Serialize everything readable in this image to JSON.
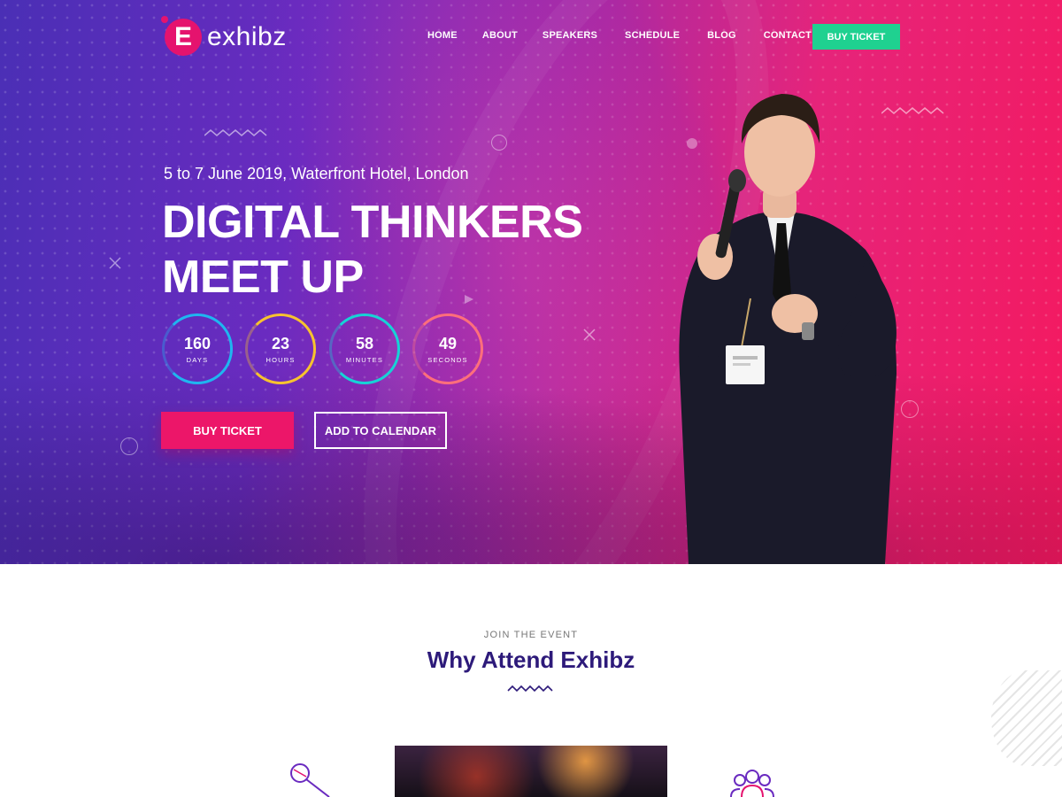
{
  "brand": {
    "name": "exhibz",
    "mark": "E"
  },
  "nav": {
    "items": [
      "HOME",
      "ABOUT",
      "SPEAKERS",
      "SCHEDULE",
      "BLOG",
      "CONTACT"
    ],
    "cta": "BUY TICKET"
  },
  "hero": {
    "date_location": "5 to 7 June 2019, Waterfront Hotel, London",
    "title_line1": "DIGITAL THINKERS",
    "title_line2": "MEET UP",
    "countdown": [
      {
        "value": "160",
        "label": "DAYS",
        "color": "#1fb6f0"
      },
      {
        "value": "23",
        "label": "HOURS",
        "color": "#f7c32e"
      },
      {
        "value": "58",
        "label": "MINUTES",
        "color": "#16d3d6"
      },
      {
        "value": "49",
        "label": "SECONDS",
        "color": "#ff6f7b"
      }
    ],
    "buy_ticket": "BUY TICKET",
    "add_to_calendar": "ADD TO CALENDAR"
  },
  "section": {
    "eyebrow": "JOIN THE EVENT",
    "title": "Why Attend Exhibz"
  },
  "colors": {
    "accent": "#ec1669",
    "cta_green": "#1fd190",
    "heading": "#2d1a7a"
  },
  "icons": [
    "microphone-icon",
    "group-icon"
  ]
}
